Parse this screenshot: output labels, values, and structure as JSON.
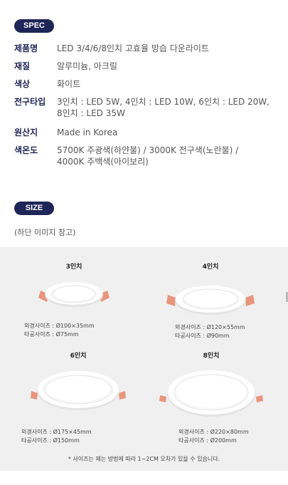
{
  "spec": {
    "badge": "SPEC",
    "rows": [
      {
        "label": "제품명",
        "lines": [
          "LED 3/4/6/8인치 고효율 방습 다운라이트"
        ]
      },
      {
        "label": "재질",
        "lines": [
          "알루미늄, 아크릴"
        ]
      },
      {
        "label": "색상",
        "lines": [
          "화이트"
        ]
      },
      {
        "label": "전구타입",
        "lines": [
          "3인치 : LED 5W, 4인치 : LED 10W, 6인치 : LED 20W,",
          "8인치 : LED 35W"
        ]
      },
      {
        "label": "원산지",
        "lines": [
          "Made in Korea"
        ]
      },
      {
        "label": "색온도",
        "lines": [
          "5700K 주광색(하얀불) / 3000K 전구색(노란불) /",
          "4000K 주백색(아이보리)"
        ]
      }
    ]
  },
  "size": {
    "badge": "SIZE",
    "note": "(하단 이미지 참고)",
    "products": [
      {
        "title": "3인치",
        "outer": "외경사이즈 : Ø100×35mm",
        "hole": "타공사이즈 : Ø75mm"
      },
      {
        "title": "4인치",
        "outer": "외경사이즈 : Ø120×55mm",
        "hole": "타공사이즈 : Ø90mm"
      },
      {
        "title": "6인치",
        "outer": "외경사이즈 : Ø175×45mm",
        "hole": "타공사이즈 : Ø150mm"
      },
      {
        "title": "8인치",
        "outer": "외경사이즈 : Ø220×80mm",
        "hole": "타공사이즈 : Ø200mm"
      }
    ],
    "footnote": "* 사이즈는 재는 방법에 따라 1~2CM 오차가 있을 수 있습니다."
  },
  "colors": {
    "badge_bg": "#1e2557",
    "spring_clip": "#e8957d",
    "background_panel": "#f0f0f0"
  }
}
